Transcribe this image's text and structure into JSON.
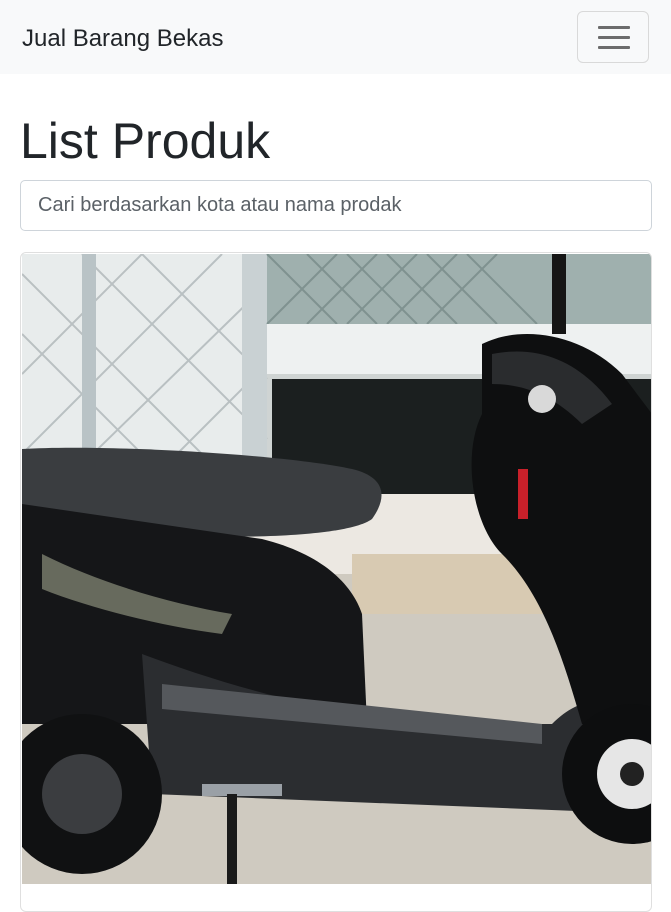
{
  "navbar": {
    "brand": "Jual Barang Bekas",
    "toggler_icon": "hamburger-menu-icon"
  },
  "main": {
    "title": "List Produk",
    "search": {
      "placeholder": "Cari berdasarkan kota atau nama prodak",
      "value": ""
    },
    "products": [
      {
        "image": "black-scooter-motorcycle-photo"
      }
    ]
  }
}
